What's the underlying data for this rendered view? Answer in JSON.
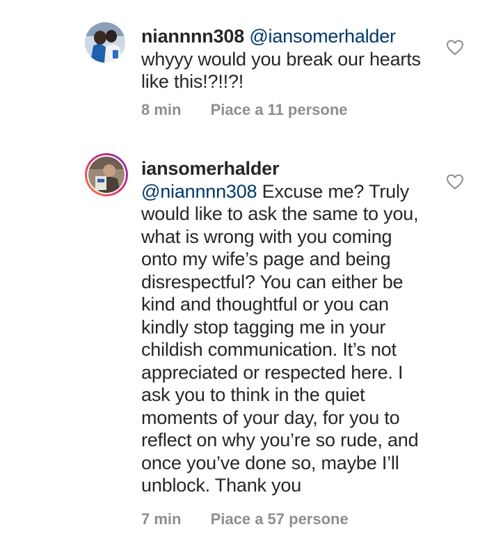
{
  "comments": [
    {
      "username": "niannnn308",
      "mention": "@iansomerhalder",
      "text": "whyyy would you break our hearts like this!?!!?!",
      "time": "8 min",
      "likes": "Piace a 11 persone",
      "heart_icon": "heart-outline-icon"
    },
    {
      "username": "iansomerhalder",
      "mention": "@niannnn308",
      "text": "Excuse me? Truly would like to ask the same to you, what is wrong with you coming onto my wife’s page and being disrespectful? You can either be kind and thoughtful or you can kindly stop tagging me in your childish communication. It’s not appreciated or respected here. I ask you to think in the quiet moments of your day, for you to reflect on why you’re so rude, and once you’ve done so, maybe I’ll unblock. Thank you",
      "time": "7 min",
      "likes": "Piace a 57 persone",
      "heart_icon": "heart-outline-icon",
      "story_ring": true
    }
  ],
  "colors": {
    "text": "#262626",
    "mention": "#00376b",
    "meta": "#8e8e8e",
    "ring_start": "#f58529",
    "ring_end": "#dd2a7b"
  }
}
